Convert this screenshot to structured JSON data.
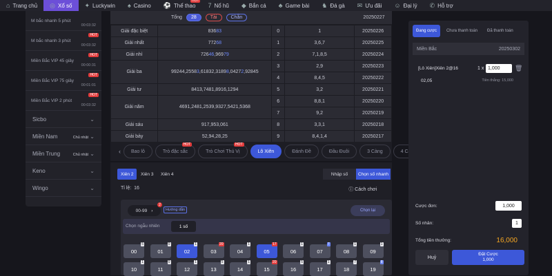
{
  "topnav": [
    {
      "label": "Trang chủ",
      "icon": "home-icon",
      "active": false
    },
    {
      "label": "Xổ số",
      "icon": "lottery-icon",
      "active": true
    },
    {
      "label": "Luckywin",
      "icon": "luckywin-icon",
      "active": false
    },
    {
      "label": "Casino",
      "icon": "casino-icon",
      "active": false
    },
    {
      "label": "Thể thao",
      "icon": "sports-icon",
      "active": false,
      "badge": "HOT"
    },
    {
      "label": "Nổ hũ",
      "icon": "slot-icon",
      "active": false
    },
    {
      "label": "Bắn cá",
      "icon": "fish-icon",
      "active": false
    },
    {
      "label": "Game bài",
      "icon": "cards-icon",
      "active": false
    },
    {
      "label": "Đá gà",
      "icon": "rooster-icon",
      "active": false
    },
    {
      "label": "Ưu đãi",
      "icon": "gift-icon",
      "active": false
    },
    {
      "label": "Đại lý",
      "icon": "agent-icon",
      "active": false
    },
    {
      "label": "Hỗ trợ",
      "icon": "support-icon",
      "active": false
    }
  ],
  "sidebar": {
    "games": [
      {
        "label": "M bắc nhanh 5 phút",
        "time": "00:03:32",
        "hot": false
      },
      {
        "label": "M bắc nhanh 3 phút",
        "time": "00:03:32",
        "hot": true
      },
      {
        "label": "Miền Bắc VIP 45 giây",
        "time": "00:00:31",
        "hot": true
      },
      {
        "label": "Miền Bắc VIP 75 giây",
        "time": "00:01:01",
        "hot": true
      },
      {
        "label": "Miền Bắc VIP 2 phút",
        "time": "00:03:32",
        "hot": true
      }
    ],
    "hot_label": "HOT",
    "regions": [
      {
        "label": "Sicbo",
        "select": ""
      },
      {
        "label": "Miền Nam",
        "select": "Chủ nhật"
      },
      {
        "label": "Miền Trung",
        "select": "Chủ nhật"
      },
      {
        "label": "Keno",
        "select": ""
      },
      {
        "label": "Wingo",
        "select": ""
      }
    ]
  },
  "results": {
    "tong_label": "Tổng",
    "tong_value": "28",
    "tai": "Tài",
    "chan": "Chẵn",
    "top_date": "20250227",
    "rows": [
      {
        "prize": "Giải đặc biệt",
        "nums": [
          "836",
          "83"
        ],
        "d": "0",
        "v": "1",
        "date": "20250226"
      },
      {
        "prize": "Giải nhất",
        "nums": [
          "772",
          "68"
        ],
        "d": "1",
        "v": "3,6,7",
        "date": "20250225"
      },
      {
        "prize": "Giải nhì",
        "nums": [
          "726",
          "46",
          ",969",
          "79"
        ],
        "d": "2",
        "v": "7,1,8,5",
        "date": "20250224"
      },
      {
        "prize": "Giải ba",
        "nums": [
          "99244,2558",
          "3",
          ",61832,3189",
          "8",
          ",0427",
          "2",
          ",92845"
        ],
        "d": "3",
        "v": "2,9",
        "date": "20250223",
        "d2": "4",
        "v2": "8,4,5",
        "date2": "20250222"
      },
      {
        "prize": "Giải tư",
        "nums": [
          "8413,7481,8916,1294"
        ],
        "d": "5",
        "v": "3,2",
        "date": "20250221"
      },
      {
        "prize": "Giải năm",
        "nums": [
          "4691,2481,2539,9327,5421,5368"
        ],
        "d": "6",
        "v": "8,8,1",
        "date": "20250220",
        "d2": "7",
        "v2": "9,2",
        "date2": "20250219"
      },
      {
        "prize": "Giải sáu",
        "nums": [
          "917,953,061"
        ],
        "d": "8",
        "v": "3,3,1",
        "date": "20250218"
      },
      {
        "prize": "Giải bảy",
        "nums": [
          "52,94,28,25"
        ],
        "d": "9",
        "v": "8,4,1,4",
        "date": "20250217"
      }
    ]
  },
  "tabs": [
    {
      "label": "Bao lô",
      "active": false,
      "hot": false
    },
    {
      "label": "Trò đặc sắc",
      "active": false,
      "hot": true
    },
    {
      "label": "Trò Chơi Thú Vị",
      "active": false,
      "hot": true
    },
    {
      "label": "Lô Xiên",
      "active": true,
      "hot": false
    },
    {
      "label": "Đánh Đề",
      "active": false,
      "hot": false
    },
    {
      "label": "Đầu Đuôi",
      "active": false,
      "hot": false
    },
    {
      "label": "3 Càng",
      "active": false,
      "hot": false
    },
    {
      "label": "4 Càng",
      "active": false,
      "hot": false
    }
  ],
  "bet": {
    "xien": [
      {
        "label": "Xiên 2",
        "active": true
      },
      {
        "label": "Xiên 3",
        "active": false
      },
      {
        "label": "Xiên 4",
        "active": false
      }
    ],
    "mode_input": "Nhập số",
    "mode_pick": "Chọn số nhanh",
    "ratio_label": "Tỉ lệ:",
    "ratio_value": "16",
    "how_to": "Cách chơi",
    "range": "00-99",
    "range_badge": "2",
    "guide": "Hướng dẫn",
    "reset": "Chọn lại",
    "random_label": "Chọn ngẫu nhiên",
    "random_value": "1 số",
    "numbers": [
      {
        "n": "00",
        "c": "5",
        "sel": false,
        "ct": "w"
      },
      {
        "n": "01",
        "c": "0",
        "sel": false,
        "ct": "w"
      },
      {
        "n": "02",
        "c": "1",
        "sel": true,
        "ct": "w"
      },
      {
        "n": "03",
        "c": "20",
        "sel": false,
        "ct": "r"
      },
      {
        "n": "04",
        "c": "1",
        "sel": false,
        "ct": "w"
      },
      {
        "n": "05",
        "c": "17",
        "sel": true,
        "ct": "r"
      },
      {
        "n": "06",
        "c": "1",
        "sel": false,
        "ct": "w"
      },
      {
        "n": "07",
        "c": "7",
        "sel": false,
        "ct": "b"
      },
      {
        "n": "08",
        "c": "1",
        "sel": false,
        "ct": "w"
      },
      {
        "n": "09",
        "c": "1",
        "sel": false,
        "ct": "w"
      },
      {
        "n": "10",
        "c": "1",
        "sel": false,
        "ct": "w"
      },
      {
        "n": "11",
        "c": "0",
        "sel": false,
        "ct": "w"
      },
      {
        "n": "12",
        "c": "1",
        "sel": false,
        "ct": "w"
      },
      {
        "n": "13",
        "c": "5",
        "sel": false,
        "ct": "w"
      },
      {
        "n": "14",
        "c": "1",
        "sel": false,
        "ct": "w"
      },
      {
        "n": "15",
        "c": "20",
        "sel": false,
        "ct": "r"
      },
      {
        "n": "16",
        "c": "5",
        "sel": false,
        "ct": "w"
      },
      {
        "n": "17",
        "c": "1",
        "sel": false,
        "ct": "w"
      },
      {
        "n": "18",
        "c": "7",
        "sel": false,
        "ct": "w"
      },
      {
        "n": "19",
        "c": "8",
        "sel": false,
        "ct": "b"
      }
    ]
  },
  "slip": {
    "tabs": [
      {
        "label": "Đang cược",
        "active": true
      },
      {
        "label": "Chưa thanh toán",
        "active": false
      },
      {
        "label": "Đã thanh toán",
        "active": false
      }
    ],
    "region": "Miền Bắc",
    "region_date": "20250302",
    "title": "[Lô Xiên]Xiên 2@16",
    "multiplier": "1 x",
    "amount": "1,000",
    "numbers": "02,05",
    "win": "Tiền thắng: 15,000",
    "unit_label": "Cược đơn:",
    "unit_value": "1,000",
    "count_label": "Số nhân:",
    "count_value": "1",
    "total_label": "Tổng tiền thưởng:",
    "total_value": "16,000",
    "cancel": "Huỷ",
    "place": "Đặt Cược",
    "place_amount": "1,000"
  },
  "colors": {
    "accent": "#3d58d9",
    "active_nav": "#6c4fd8",
    "hot": "#e23b3b",
    "total": "#f5a623"
  }
}
